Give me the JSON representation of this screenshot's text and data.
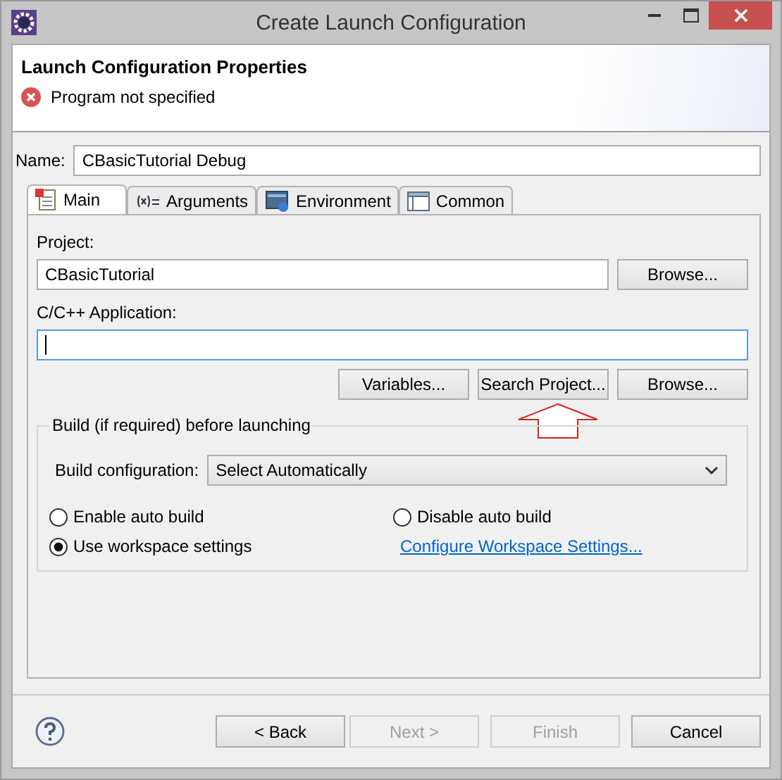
{
  "window": {
    "title": "Create Launch Configuration"
  },
  "header": {
    "title": "Launch Configuration Properties",
    "message": "Program not specified"
  },
  "name": {
    "label": "Name:",
    "value": "CBasicTutorial Debug"
  },
  "tabs": [
    {
      "label": "Main",
      "kind": "main",
      "selected": true
    },
    {
      "label": "Arguments",
      "kind": "arguments",
      "selected": false
    },
    {
      "label": "Environment",
      "kind": "environment",
      "selected": false
    },
    {
      "label": "Common",
      "kind": "common",
      "selected": false
    }
  ],
  "project": {
    "label": "Project:",
    "value": "CBasicTutorial",
    "button": "Browse..."
  },
  "application": {
    "label": "C/C++ Application:",
    "focused": true,
    "buttons": [
      "Variables...",
      "Search Project...",
      "Browse..."
    ]
  },
  "build": {
    "title": "Build (if required) before launching",
    "config_label": "Build configuration:",
    "config_value": "Select Automatically",
    "options": [
      {
        "label": "Enable auto build",
        "selected": false
      },
      {
        "label": "Disable auto build",
        "selected": false
      },
      {
        "label": "Use workspace settings",
        "selected": true
      }
    ],
    "link": "Configure Workspace Settings..."
  },
  "buttons": [
    {
      "label": "< Back",
      "disabled": false
    },
    {
      "label": "Next >",
      "disabled": true
    },
    {
      "label": "Finish",
      "disabled": true
    },
    {
      "label": "Cancel",
      "disabled": false
    }
  ]
}
